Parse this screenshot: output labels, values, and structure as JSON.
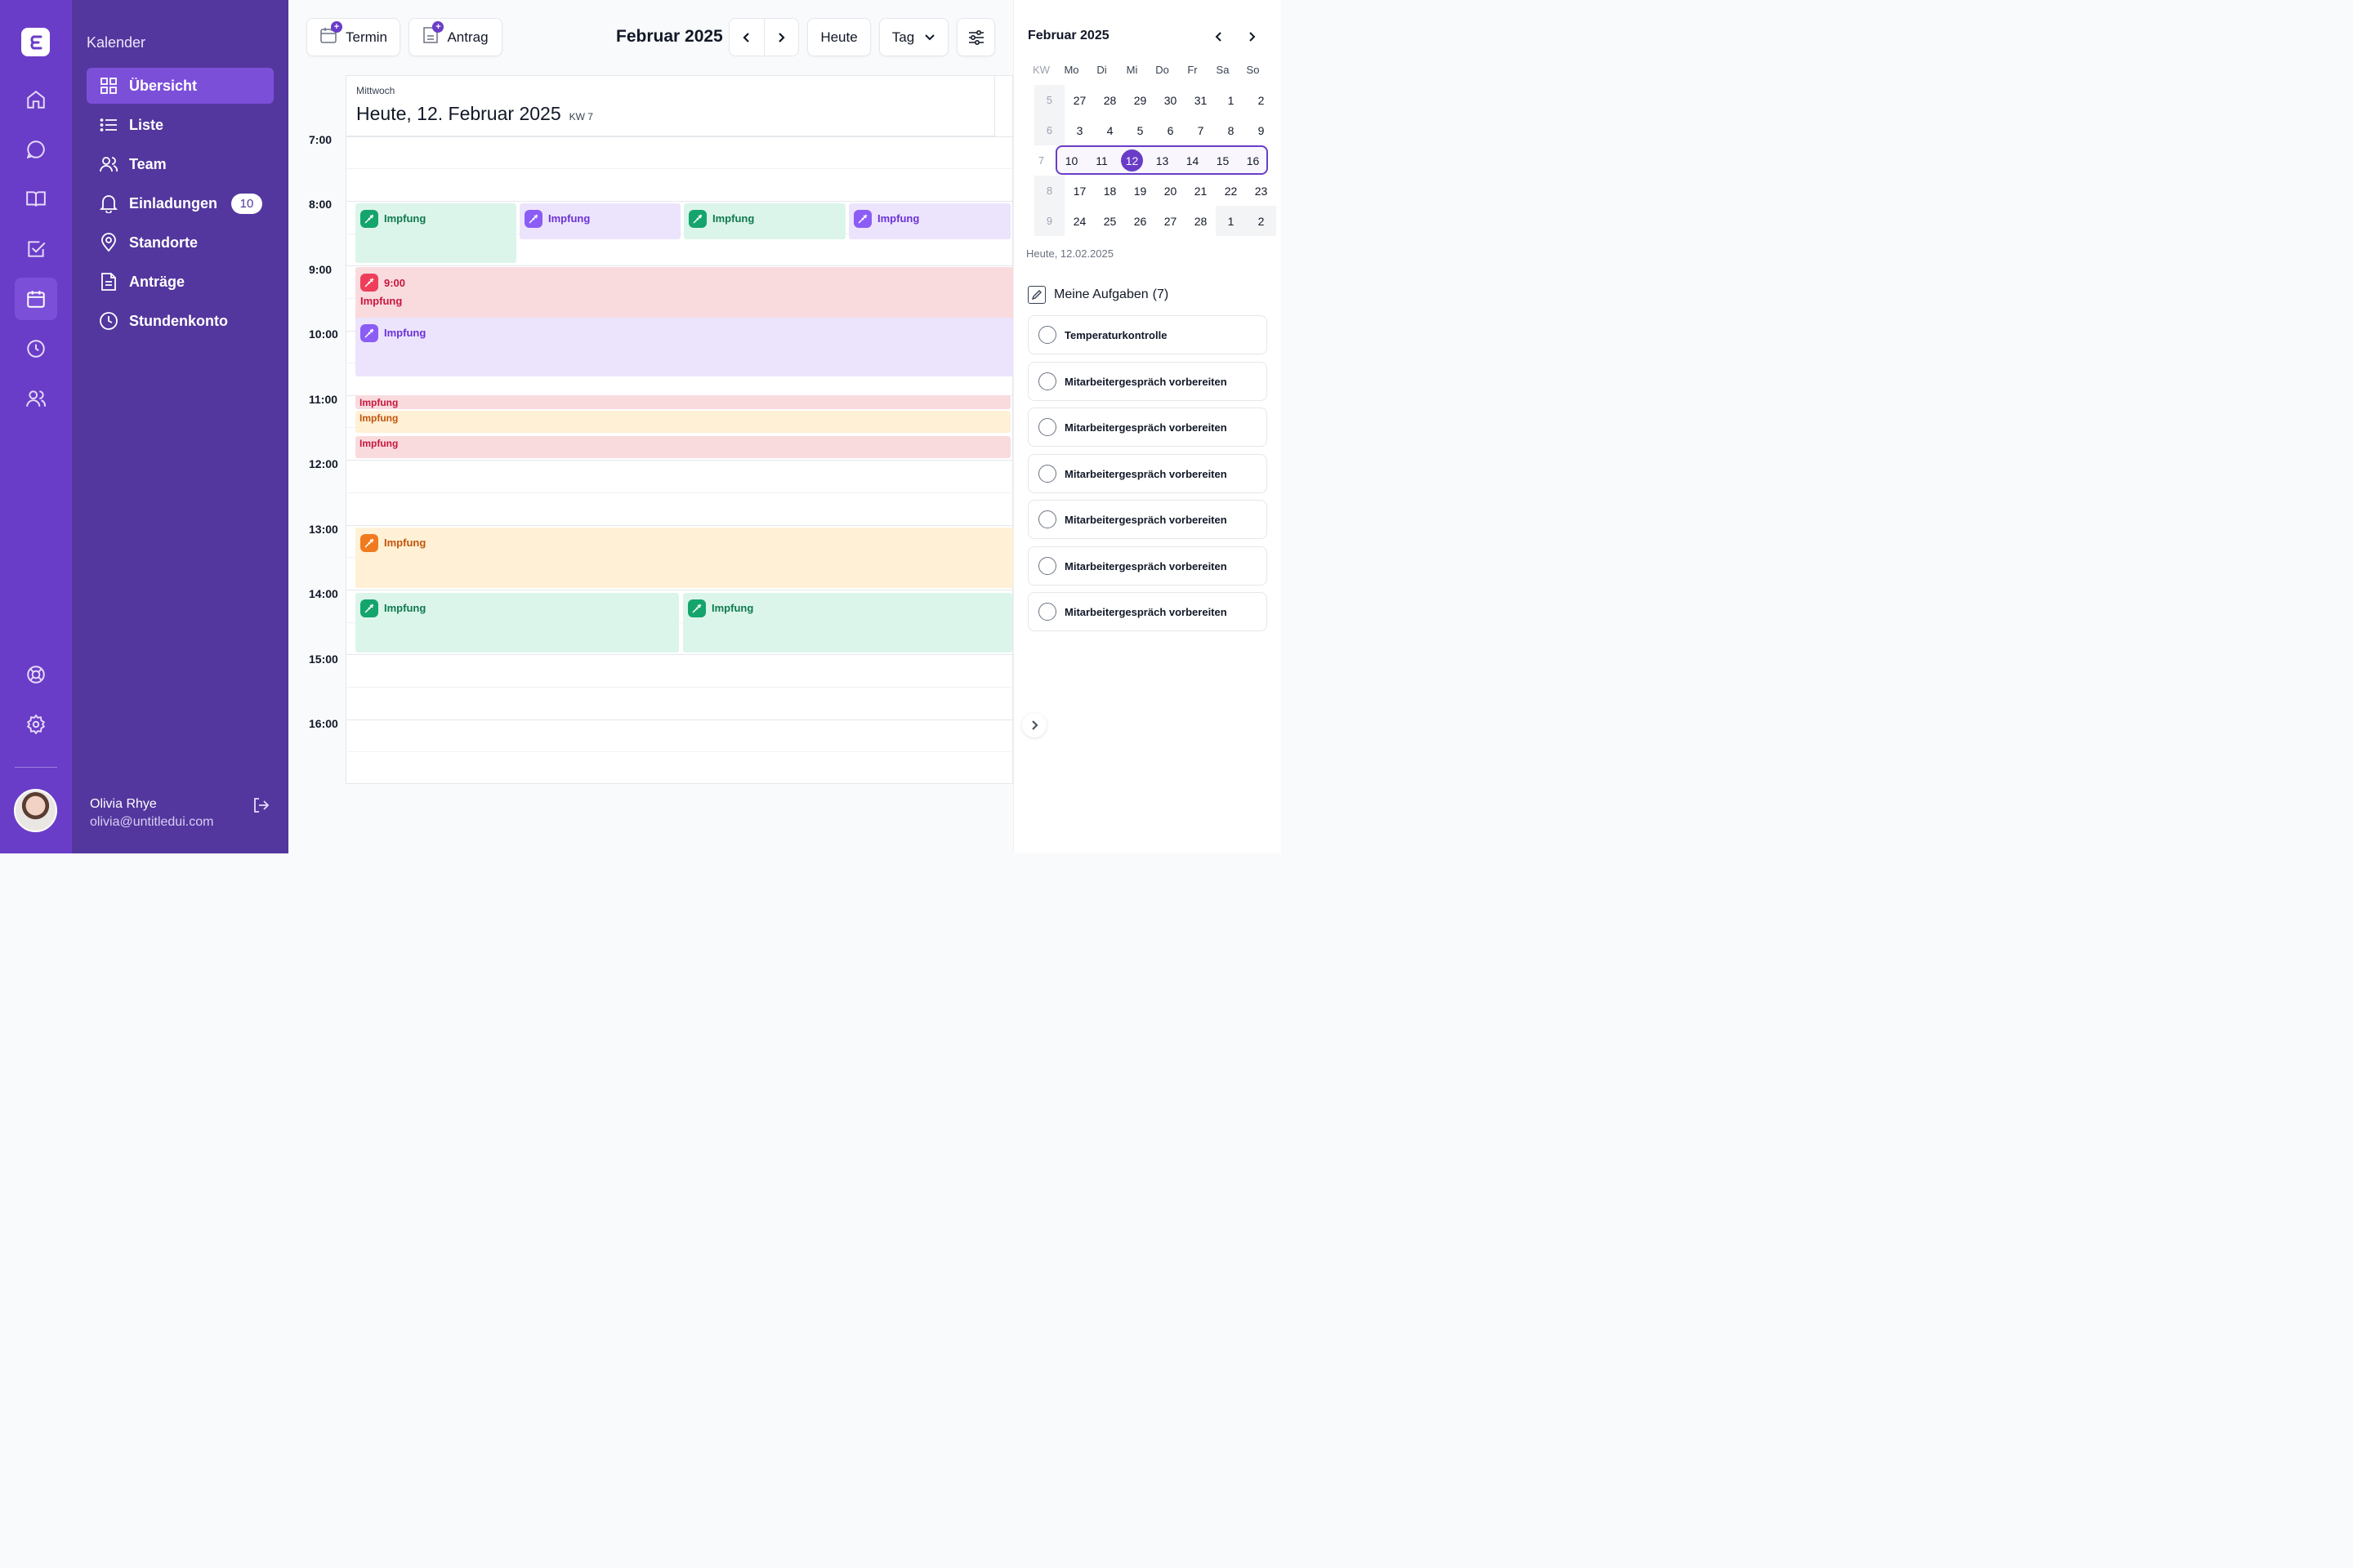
{
  "sidebar": {
    "title": "Kalender",
    "items": [
      {
        "label": "Übersicht"
      },
      {
        "label": "Liste"
      },
      {
        "label": "Team"
      },
      {
        "label": "Einladungen",
        "badge": "10"
      },
      {
        "label": "Standorte"
      },
      {
        "label": "Anträge"
      },
      {
        "label": "Stundenkonto"
      }
    ],
    "user": {
      "name": "Olivia Rhye",
      "email": "olivia@untitledui.com"
    }
  },
  "toolbar": {
    "termin_label": "Termin",
    "antrag_label": "Antrag",
    "month_title": "Februar 2025",
    "today_label": "Heute",
    "view_label": "Tag"
  },
  "day": {
    "weekday": "Mittwoch",
    "title": "Heute, 12. Februar 2025",
    "kw": "KW 7",
    "hours": [
      "7:00",
      "8:00",
      "9:00",
      "10:00",
      "11:00",
      "12:00",
      "13:00",
      "14:00",
      "15:00",
      "16:00"
    ]
  },
  "events": {
    "e1": "Impfung",
    "e2": "Impfung",
    "e3": "Impfung",
    "e4": "Impfung",
    "e5_time": "9:00",
    "e5": "Impfung",
    "e6": "Impfung",
    "e7": "Impfung",
    "e8": "Impfung",
    "e9": "Impfung",
    "e10": "Impfung",
    "e11": "Impfung",
    "e12": "Impfung"
  },
  "minical": {
    "title": "Februar 2025",
    "headers": [
      "KW",
      "Mo",
      "Di",
      "Mi",
      "Do",
      "Fr",
      "Sa",
      "So"
    ],
    "rows": [
      [
        "5",
        "27",
        "28",
        "29",
        "30",
        "31",
        "1",
        "2"
      ],
      [
        "6",
        "3",
        "4",
        "5",
        "6",
        "7",
        "8",
        "9"
      ],
      [
        "7",
        "10",
        "11",
        "12",
        "13",
        "14",
        "15",
        "16"
      ],
      [
        "8",
        "17",
        "18",
        "19",
        "20",
        "21",
        "22",
        "23"
      ],
      [
        "9",
        "24",
        "25",
        "26",
        "27",
        "28",
        "1",
        "2"
      ]
    ],
    "today_text": "Heute, 12.02.2025"
  },
  "tasks": {
    "heading": "Meine Aufgaben",
    "count": "(7)",
    "items": [
      "Temperaturkontrolle",
      "Mitarbeitergespräch vorbereiten",
      "Mitarbeitergespräch vorbereiten",
      "Mitarbeitergespräch vorbereiten",
      "Mitarbeitergespräch vorbereiten",
      "Mitarbeitergespräch vorbereiten",
      "Mitarbeitergespräch vorbereiten"
    ]
  },
  "colors": {
    "brand": "#6a3dc8",
    "sidebar": "#53379e",
    "green_event": "#dcf5ea",
    "purple_event": "#ece4fd",
    "red_event": "#f9dbde",
    "orange_event": "#fff0d6"
  },
  "icons": {
    "rail": [
      "home-icon",
      "chat-icon",
      "book-icon",
      "check-square-icon",
      "calendar-icon",
      "clock-icon",
      "users-icon",
      "lifebuoy-icon",
      "settings-icon"
    ],
    "event": "syringe-icon"
  }
}
